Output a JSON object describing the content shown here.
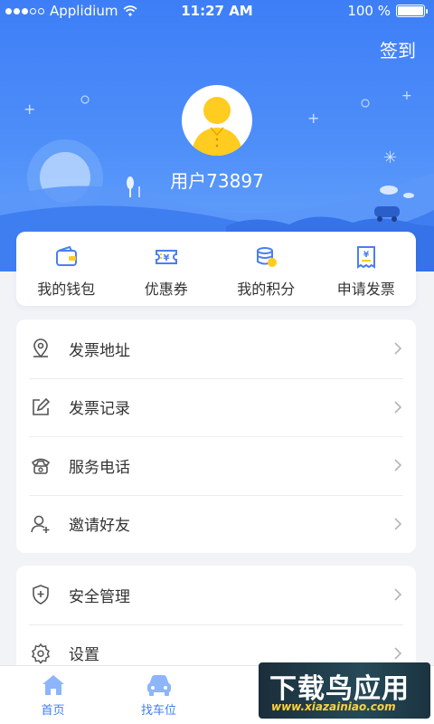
{
  "status_bar": {
    "carrier": "Applidium",
    "time": "11:27 AM",
    "battery": "100 %"
  },
  "header": {
    "signin": "签到",
    "username": "用户73897"
  },
  "quick_actions": [
    {
      "label": "我的钱包",
      "icon": "wallet-icon"
    },
    {
      "label": "优惠券",
      "icon": "coupon-icon"
    },
    {
      "label": "我的积分",
      "icon": "coins-icon"
    },
    {
      "label": "申请发票",
      "icon": "invoice-icon"
    }
  ],
  "menu_group_1": [
    {
      "label": "发票地址",
      "icon": "location-pin-icon"
    },
    {
      "label": "发票记录",
      "icon": "edit-icon"
    },
    {
      "label": "服务电话",
      "icon": "phone-icon"
    },
    {
      "label": "邀请好友",
      "icon": "add-user-icon"
    }
  ],
  "menu_group_2": [
    {
      "label": "安全管理",
      "icon": "shield-icon"
    },
    {
      "label": "设置",
      "icon": "gear-icon"
    }
  ],
  "tabbar": [
    {
      "label": "首页",
      "icon": "home-icon"
    },
    {
      "label": "找车位",
      "icon": "car-icon"
    }
  ],
  "watermark": {
    "title": "下载鸟应用",
    "url": "www.xiazainiao.com"
  },
  "colors": {
    "primary": "#3d7ef7",
    "accent": "#ffcc1f",
    "text": "#333333"
  }
}
